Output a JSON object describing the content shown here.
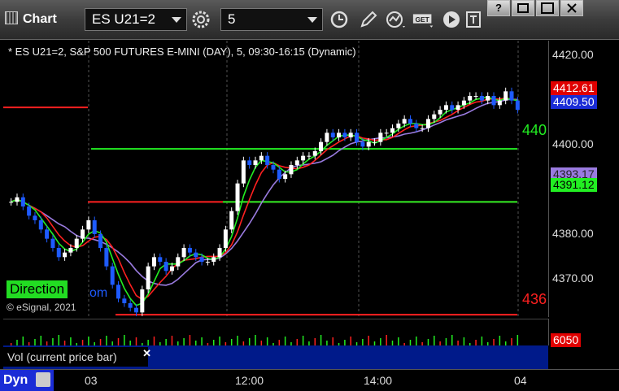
{
  "toolbar": {
    "title": "Chart",
    "symbol": "ES U21=2",
    "interval": "5",
    "get_label": "GET"
  },
  "window_buttons": [
    "?",
    "",
    "",
    ""
  ],
  "chart": {
    "legend": "* ES U21=2, S&P 500 FUTURES E-MINI (DAY), 5, 09:30-16:15 (Dynamic)",
    "direction_label": "Direction",
    "partial_label": "om",
    "copyright": "© eSignal, 2021",
    "hline_green_label": "440",
    "hline_red_label": "436",
    "price_ticks": [
      "4420.00",
      "4410.00",
      "4400.00",
      "4390.00",
      "4380.00",
      "4370.00"
    ],
    "price_tag_red": "4412.61",
    "price_tag_blue": "4409.50",
    "price_tag_purple": "4393.17",
    "price_tag_green": "4391.12",
    "vol_label": "Vol (current price bar)",
    "vol_value": "6050",
    "dyn_label": "Dyn",
    "time_ticks": [
      "03",
      "12:00",
      "14:00",
      "04"
    ]
  },
  "colors": {
    "up": "#ffffff",
    "down": "#1e5bff",
    "red_line": "#ff2020",
    "green_line": "#22ee22",
    "purple_line": "#9a7be0"
  },
  "chart_data": {
    "type": "candlestick",
    "ylim": [
      4365,
      4425
    ],
    "series": [
      {
        "name": "close",
        "values": [
          4390,
          4391,
          4389,
          4387,
          4386,
          4384,
          4382,
          4380,
          4378,
          4379,
          4380,
          4382,
          4384,
          4386,
          4383,
          4380,
          4376,
          4372,
          4369,
          4368,
          4367,
          4366,
          4371,
          4376,
          4378,
          4377,
          4375,
          4376,
          4378,
          4380,
          4379,
          4378,
          4377,
          4377,
          4378,
          4380,
          4384,
          4388,
          4394,
          4399,
          4398,
          4399,
          4400,
          4398,
          4397,
          4395,
          4396,
          4398,
          4399,
          4400,
          4400,
          4401,
          4403,
          4405,
          4404,
          4405,
          4404,
          4405,
          4403,
          4402,
          4403,
          4403,
          4405,
          4405,
          4406,
          4407,
          4408,
          4407,
          4406,
          4406,
          4408,
          4409,
          4410,
          4411,
          4410,
          4411,
          4412,
          4413,
          4413,
          4412,
          4413,
          4411,
          4412,
          4414,
          4412,
          4410
        ]
      }
    ]
  }
}
